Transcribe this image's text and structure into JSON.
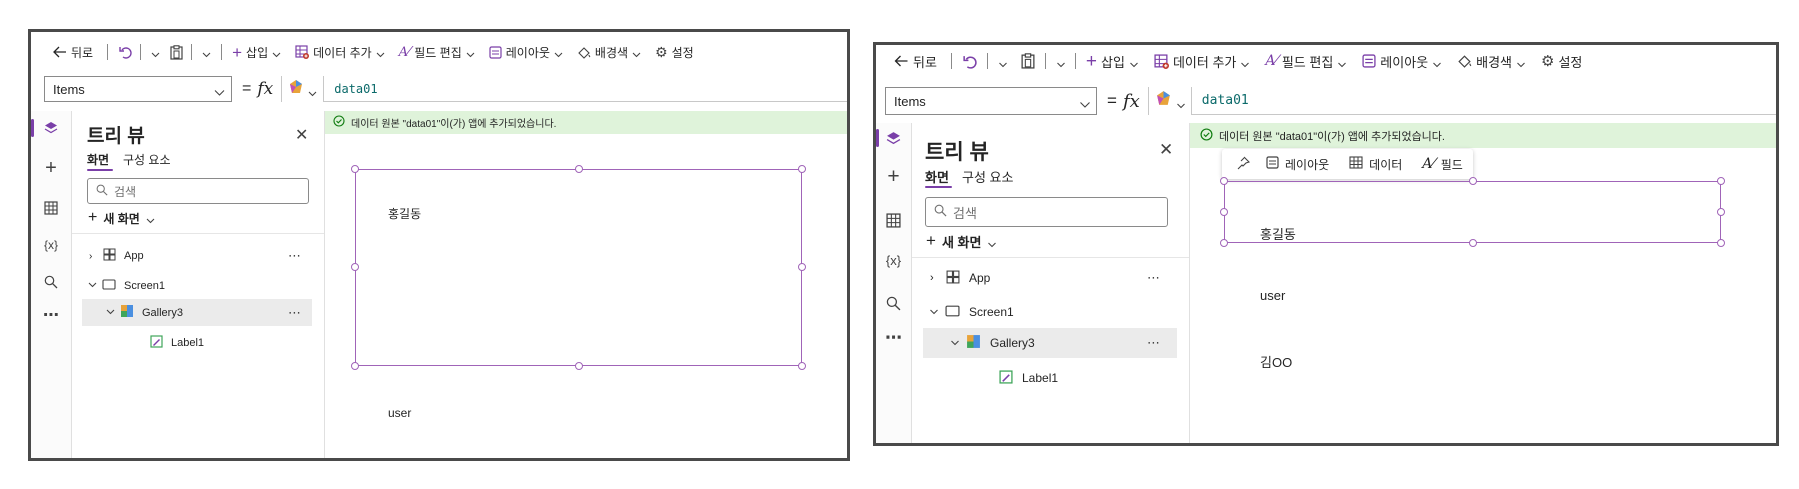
{
  "toolbar": {
    "back": "뒤로",
    "insert": "삽입",
    "add_data": "데이터 추가",
    "edit_fields": "필드 편집",
    "layout": "레이아웃",
    "background": "배경색",
    "settings": "설정"
  },
  "formula_bar": {
    "property": "Items",
    "equals": "=",
    "fx": "fx",
    "formula": "data01"
  },
  "tree_view": {
    "title": "트리 뷰",
    "tab_screens": "화면",
    "tab_components": "구성 요소",
    "search_placeholder": "검색",
    "new_screen": "새 화면",
    "items": [
      {
        "label": "App"
      },
      {
        "label": "Screen1"
      },
      {
        "label": "Gallery3"
      },
      {
        "label": "Label1"
      }
    ]
  },
  "canvas": {
    "banner": "데이터 원본 \"data01\"이(가) 앱에 추가되었습니다.",
    "gallery_items": [
      "홍길동",
      "user",
      "김OO"
    ]
  },
  "context_toolbar": {
    "layout": "레이아웃",
    "data": "데이터",
    "fields": "필드"
  },
  "colors": {
    "accent": "#7a3fa8",
    "selection": "#a064b8",
    "banner_bg": "#dff3da",
    "success": "#107c10"
  }
}
